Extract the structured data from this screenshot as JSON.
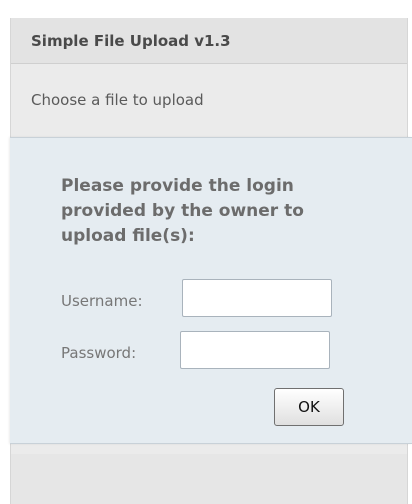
{
  "app": {
    "title": "Simple File Upload v1.3",
    "subtitle": "Choose a file to upload"
  },
  "login_dialog": {
    "prompt": "Please provide the login provided by the owner to upload file(s):",
    "username_label": "Username:",
    "username_value": "",
    "password_label": "Password:",
    "password_value": "",
    "ok_label": "OK"
  },
  "colors": {
    "panel_background": "#ebebeb",
    "dialog_background": "#e5ecf1",
    "title_text": "#4a4a4a",
    "prompt_text": "#6c6c6c",
    "label_text": "#777777"
  }
}
